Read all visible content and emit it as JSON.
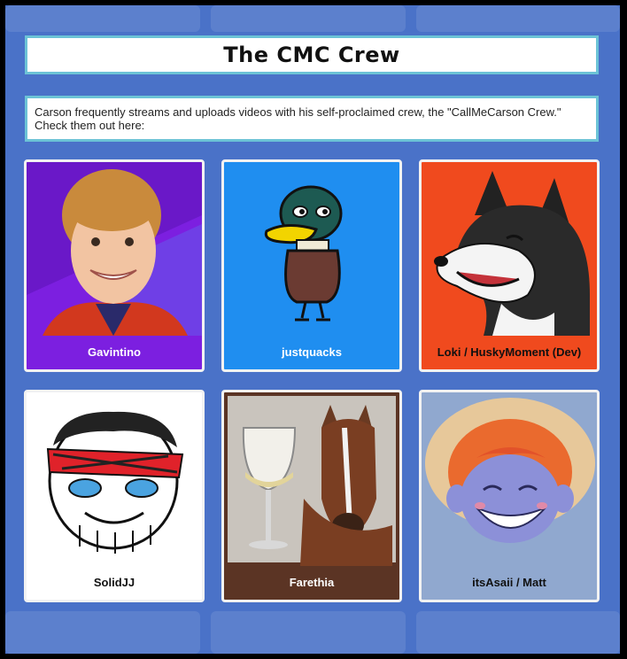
{
  "page": {
    "title": "The CMC Crew",
    "description": "Carson frequently streams and uploads videos with his self-proclaimed crew, the \"CallMeCarson Crew.\" Check them out here:"
  },
  "crew": [
    {
      "name": "Gavintino",
      "icon": "boy-portrait",
      "color": "#7c1fe0"
    },
    {
      "name": "justquacks",
      "icon": "duck-drawing",
      "color": "#1f8ef0"
    },
    {
      "name": "Loki / HuskyMoment (Dev)",
      "icon": "husky-wolf-drawing",
      "color": "#f04a1e"
    },
    {
      "name": "SolidJJ",
      "icon": "sketch-face-headband",
      "color": "#ffffff"
    },
    {
      "name": "Farethia",
      "icon": "horse-with-wine-glass",
      "color": "#5b3424"
    },
    {
      "name": "itsAsaii / Matt",
      "icon": "smiling-character-straw-hat",
      "color": "#90a8cf"
    }
  ]
}
